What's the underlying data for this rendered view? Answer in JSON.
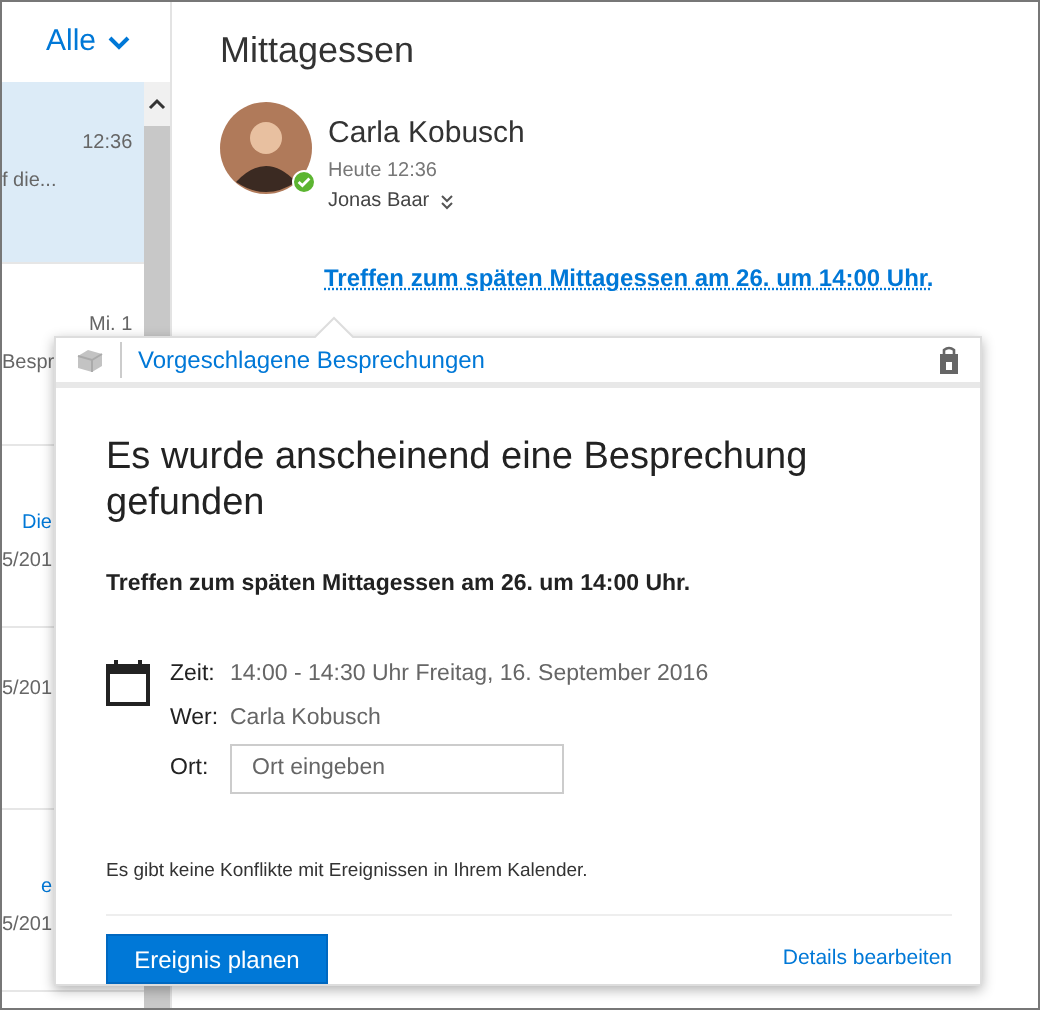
{
  "filter": {
    "label": "Alle"
  },
  "messages": [
    {
      "time": "12:36",
      "preview": "f die...",
      "selected": true
    },
    {
      "time": "Mi. 1",
      "preview": "Bespr",
      "selected": false
    },
    {
      "sender": "Die",
      "preview": "5/201",
      "selected": false
    },
    {
      "preview": "5/201",
      "selected": false
    },
    {
      "sender": "e",
      "preview": "5/201",
      "selected": false
    }
  ],
  "reading_pane": {
    "subject": "Mittagessen",
    "sender": "Carla Kobusch",
    "sent": "Heute 12:36",
    "recipient": "Jonas Baar",
    "detected_link": "Treffen zum späten Mittagessen am 26. um 14:00 Uhr."
  },
  "popup": {
    "header": "Vorgeschlagene Besprechungen",
    "title": "Es wurde anscheinend eine Besprechung gefunden",
    "meeting": "Treffen zum späten Mittagessen am 26. um 14:00 Uhr.",
    "details": [
      {
        "kind": "text",
        "label": "Zeit:",
        "value": "14:00 - 14:30 Uhr Freitag, 16. September 2016"
      },
      {
        "kind": "text",
        "label": "Wer:",
        "value": "Carla Kobusch"
      },
      {
        "kind": "field",
        "label": "Ort:",
        "placeholder": "Ort eingeben"
      }
    ],
    "note": "Es gibt keine Konflikte mit Ereignissen in Ihrem Kalender.",
    "primary_button": "Ereignis planen",
    "secondary_link": "Details bearbeiten"
  }
}
